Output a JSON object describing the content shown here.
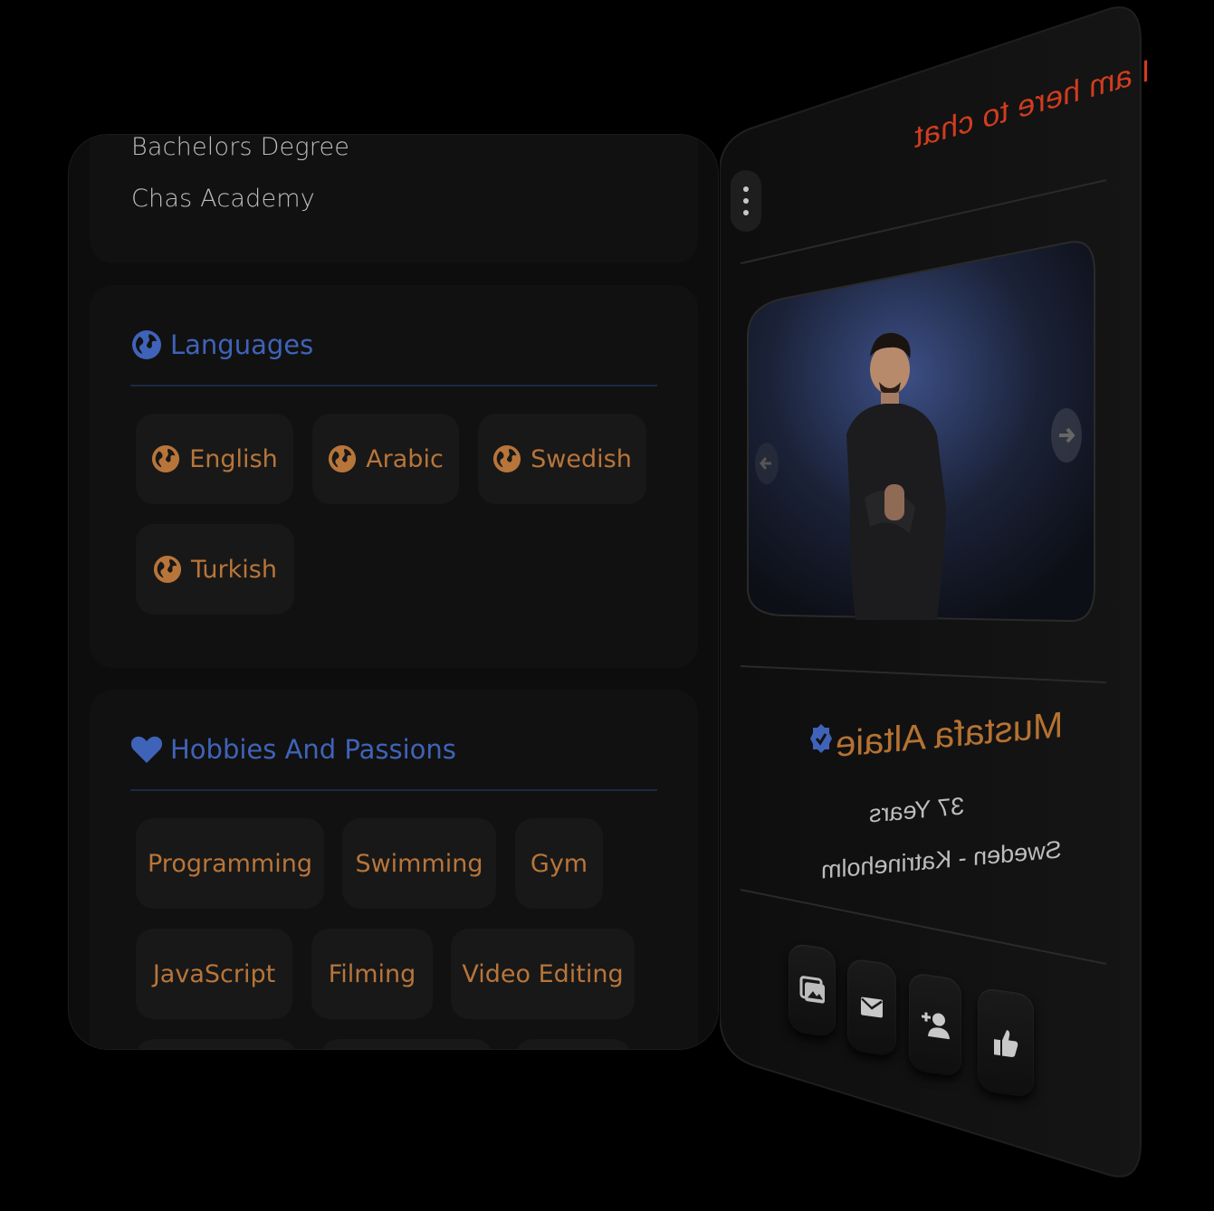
{
  "education": {
    "degree": "Bachelors Degree",
    "school": "Chas Academy"
  },
  "languages": {
    "title": "Languages",
    "items": [
      "English",
      "Arabic",
      "Swedish",
      "Turkish"
    ],
    "icon": "globe-icon",
    "title_color": "#3f63b8",
    "chip_color": "#b8753a"
  },
  "hobbies": {
    "title": "Hobbies And Passions",
    "items": [
      "Programming",
      "Swimming",
      "Gym",
      "JavaScript",
      "Filming",
      "Video Editing"
    ],
    "icon": "heart-icon"
  },
  "profile": {
    "status": "I am here to chat",
    "name": "Mustafa Altaie",
    "age": "37 Years",
    "location": "Sweden - Katrineholm",
    "verified_icon": "verified-badge-icon",
    "status_color": "#d23c1f",
    "name_color": "#b57232"
  },
  "actions": [
    "gallery-icon",
    "mail-icon",
    "add-friend-icon",
    "like-icon"
  ]
}
